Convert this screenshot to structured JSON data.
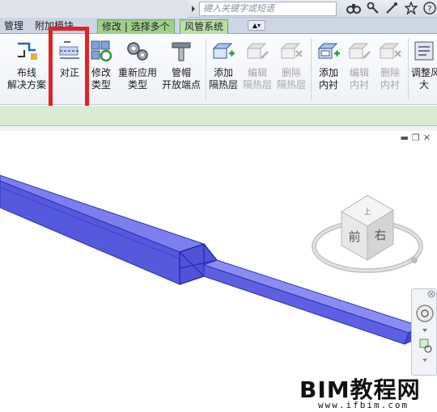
{
  "search": {
    "placeholder": "键入关键字或短语"
  },
  "tabs": [
    {
      "label": "管理"
    },
    {
      "label": "附加模块"
    },
    {
      "label": "修改 | 选择多个"
    },
    {
      "label": "风管系统"
    }
  ],
  "ribbon": {
    "buttons": [
      {
        "label1": "布线",
        "label2": "解决方案",
        "enabled": true
      },
      {
        "label1": "对正",
        "label2": "",
        "enabled": true
      },
      {
        "label1": "修改",
        "label2": "类型",
        "enabled": true
      },
      {
        "label1": "重新应用",
        "label2": "类型",
        "enabled": true
      },
      {
        "label1": "管帽",
        "label2": "开放端点",
        "enabled": true
      },
      {
        "label1": "添加",
        "label2": "隔热层",
        "enabled": true
      },
      {
        "label1": "编辑",
        "label2": "隔热层",
        "enabled": false
      },
      {
        "label1": "删除",
        "label2": "隔热层",
        "enabled": false
      },
      {
        "label1": "添加",
        "label2": "内衬",
        "enabled": true
      },
      {
        "label1": "编辑",
        "label2": "内衬",
        "enabled": false
      },
      {
        "label1": "删除",
        "label2": "内衬",
        "enabled": false
      },
      {
        "label1": "调整风",
        "label2": "大",
        "enabled": true
      }
    ]
  },
  "viewcube": {
    "front": "前",
    "right": "右",
    "top": "上"
  },
  "watermark": {
    "title": "BIM教程网",
    "url": "www.ifbim.com"
  },
  "colors": {
    "duct": "#4a4ee0",
    "context_tab": "#9fd08a",
    "highlight": "#e32222"
  }
}
